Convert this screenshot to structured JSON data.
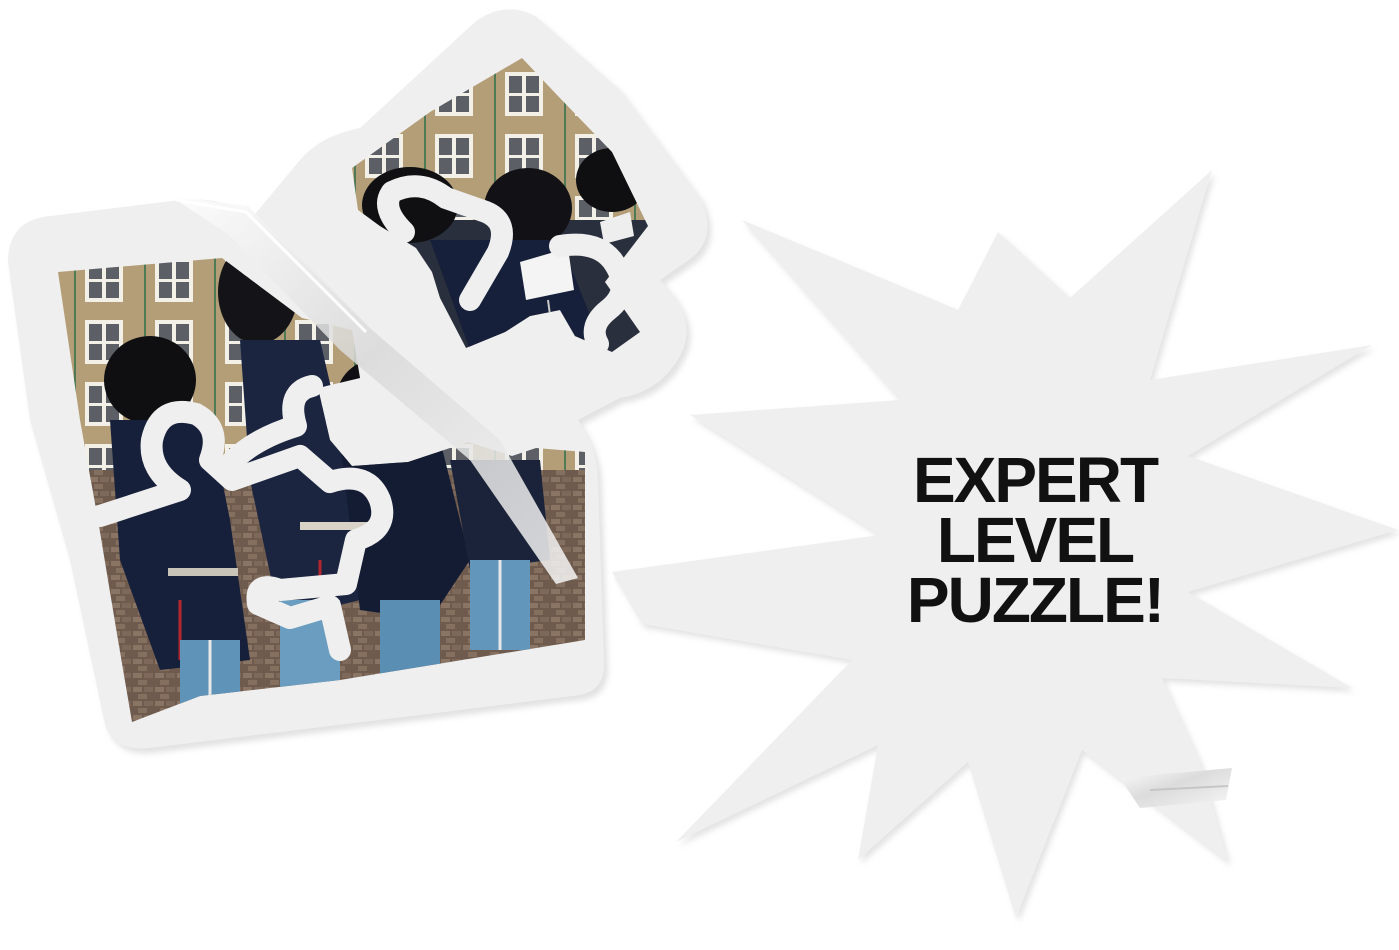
{
  "burst": {
    "line1": "EXPERT",
    "line2": "LEVEL",
    "line3": "PUZZLE!"
  },
  "colors": {
    "sticker": "#efefef",
    "sticker_shadow": "#d8d8d8",
    "text": "#111111",
    "photo_sky": "#b8a37e",
    "uniform_dark": "#17203a",
    "uniform_light": "#5f93b8"
  },
  "photo": {
    "subject": "marching band in black bearskin hats and blue trousers in front of a building"
  }
}
